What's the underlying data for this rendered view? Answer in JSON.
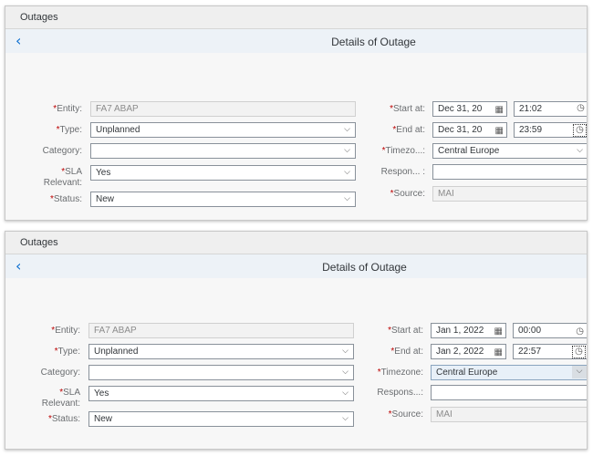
{
  "panels": [
    {
      "tab": "Outages",
      "title": "Details of Outage",
      "back_icon": "chevron-left-icon",
      "required_mark": "*",
      "left": {
        "entity_label": "Entity:",
        "entity_value": "FA7 ABAP",
        "type_label": "Type:",
        "type_value": "Unplanned",
        "category_label": "Category:",
        "category_value": "",
        "sla_label_1": "SLA",
        "sla_label_2": "Relevant:",
        "sla_value": "Yes",
        "status_label": "Status:",
        "status_value": "New"
      },
      "right": {
        "start_label": "Start at:",
        "start_date": "Dec 31, 20",
        "start_time": "21:02",
        "end_label": "End at:",
        "end_date": "Dec 31, 20",
        "end_time": "23:59",
        "tz_label": "Timezo...:",
        "tz_value": "Central Europe",
        "resp_label": "Respon... :",
        "resp_value": "",
        "source_label": "Source:",
        "source_value": "MAI"
      }
    },
    {
      "tab": "Outages",
      "title": "Details of Outage",
      "back_icon": "chevron-left-icon",
      "required_mark": "*",
      "left": {
        "entity_label": "Entity:",
        "entity_value": "FA7 ABAP",
        "type_label": "Type:",
        "type_value": "Unplanned",
        "category_label": "Category:",
        "category_value": "",
        "sla_label_1": "SLA",
        "sla_label_2": "Relevant:",
        "sla_value": "Yes",
        "status_label": "Status:",
        "status_value": "New"
      },
      "right": {
        "start_label": "Start at:",
        "start_date": "Jan 1, 2022",
        "start_time": "00:00",
        "end_label": "End at:",
        "end_date": "Jan 2, 2022",
        "end_time": "22:57",
        "tz_label": "Timezone:",
        "tz_value": "Central Europe",
        "resp_label": "Respons...:",
        "resp_value": "",
        "source_label": "Source:",
        "source_value": "MAI"
      }
    }
  ],
  "icons": {
    "dropdown": "chevron-down-icon",
    "calendar": "calendar-icon",
    "clock": "clock-icon"
  }
}
